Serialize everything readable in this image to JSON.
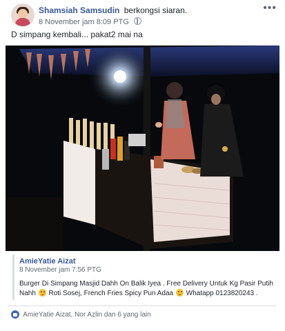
{
  "post": {
    "author_name": "Shamsiah Samsudin",
    "author_action": "berkongsi siaran.",
    "timestamp": "8 November jam 8:09 PTG",
    "more_label": "•••",
    "text": "D simpang kembali... pakat2 mai na"
  },
  "shared": {
    "author_name": "AmieYatie Aizat",
    "timestamp": "8 November jam 7:56 PTG",
    "body_part1": "Burger Di Simpang Masjid Dahh On Balik Iyea . Free Delivery Untuk Kg Pasir Putih Nahh",
    "body_part2": "Roti Sosej, French Fries Spicy Pun Adaa",
    "body_part3": "Whatapp 0123820243 ."
  },
  "reactions": {
    "text": "AmieYatie Aizat, Nor Azlin dan 6 yang lain"
  },
  "colors": {
    "link": "#385898",
    "like": "#4267b2",
    "photo_bg": "#0a0d12"
  }
}
